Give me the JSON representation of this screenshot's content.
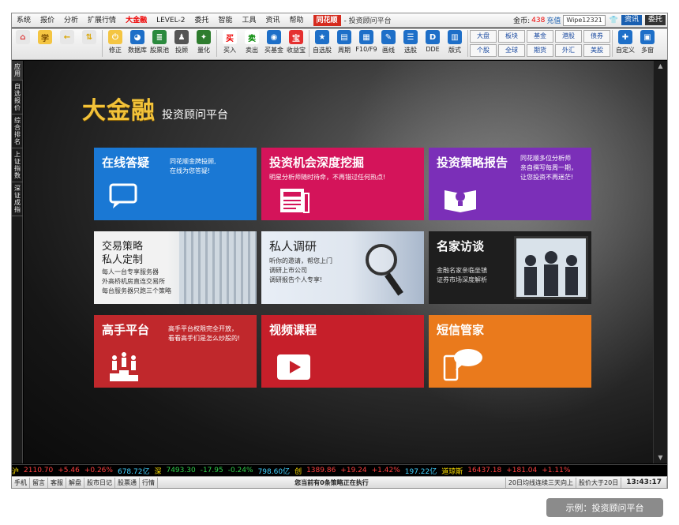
{
  "menu": {
    "items": [
      "系统",
      "报价",
      "分析",
      "扩展行情",
      "大金融",
      "LEVEL-2",
      "委托",
      "智能",
      "工具",
      "资讯",
      "帮助"
    ],
    "logo": "同花顺",
    "title": "- 投资顾问平台",
    "coins_label": "金币:",
    "coins_value": "438",
    "recharge": "充值",
    "user": "Wipe12321",
    "btn_zixun": "资讯",
    "btn_weituo": "委托"
  },
  "toolbar": {
    "buttons": [
      {
        "label": "",
        "icon": "home-icon"
      },
      {
        "label": "",
        "icon": "learn-icon"
      },
      {
        "label": "",
        "icon": "back-icon"
      },
      {
        "label": "",
        "icon": "updown-icon"
      },
      {
        "label": "修正",
        "icon": "power-icon"
      },
      {
        "label": "数据库",
        "icon": "database-icon"
      },
      {
        "label": "股票池",
        "icon": "stockpool-icon"
      },
      {
        "label": "投顾",
        "icon": "advisor-icon"
      },
      {
        "label": "量化",
        "icon": "quant-icon"
      },
      {
        "label": "买入",
        "icon": "buy-icon"
      },
      {
        "label": "卖出",
        "icon": "sell-icon"
      },
      {
        "label": "买基金",
        "icon": "fund-icon"
      },
      {
        "label": "收益宝",
        "icon": "treasure-icon"
      },
      {
        "label": "自选股",
        "icon": "watchlist-icon"
      },
      {
        "label": "周期",
        "icon": "cycle-icon"
      },
      {
        "label": "F10/F9",
        "icon": "f10-icon"
      },
      {
        "label": "画线",
        "icon": "draw-icon"
      },
      {
        "label": "选股",
        "icon": "select-icon"
      },
      {
        "label": "DDE",
        "icon": "dde-icon"
      },
      {
        "label": "版式",
        "icon": "layout-icon"
      }
    ],
    "grid": [
      "大盘",
      "板块",
      "基金",
      "港股",
      "债券",
      "个股",
      "全球",
      "期货",
      "外汇",
      "美股"
    ],
    "right": [
      {
        "label": "自定义",
        "icon": "custom-icon"
      },
      {
        "label": "多窗",
        "icon": "multiwin-icon"
      }
    ],
    "glyphs": {
      "home": "⌂",
      "learn": "学",
      "back": "←",
      "updown": "⇅",
      "power": "⏻",
      "database": "◕",
      "stockpool": "≣",
      "advisor": "♟",
      "quant": "✦",
      "buy": "买",
      "sell": "卖",
      "fund": "◉",
      "treasure": "宝",
      "watchlist": "★",
      "cycle": "▤",
      "f10": "▦",
      "draw": "✎",
      "select": "☰",
      "dde": "D",
      "layout": "▥",
      "custom": "✚",
      "multiwin": "▣"
    }
  },
  "sidetabs": [
    "应用",
    "自选报价",
    "综合排名",
    "上证指数",
    "深证成指"
  ],
  "brand": {
    "big": "大金融",
    "sub": "投资顾问平台"
  },
  "tiles": [
    {
      "title": "在线答疑",
      "desc": [
        "同花顺金牌投顾,",
        "在线为您答疑!"
      ],
      "icon": "chat-icon",
      "color": "#1a78d4"
    },
    {
      "title": "投资机会深度挖掘",
      "desc": [
        "明星分析师随时待命，不再错过任何热点!"
      ],
      "icon": "news-icon",
      "color": "#d4145a"
    },
    {
      "title": "投资策略报告",
      "desc": [
        "同花顺多位分析师",
        "亲自撰写每周一期，",
        "让您投资不再迷茫!"
      ],
      "icon": "report-icon",
      "color": "#7b2fb8"
    },
    {
      "title": "交易策略",
      "title2": "私人定制",
      "desc": [
        "每人一台专享服务器",
        "外高桥机房直连交易所",
        "每台服务器只跑三个策略"
      ],
      "icon": "server-icon",
      "color": "#e6e6e6"
    },
    {
      "title": "私人调研",
      "desc": [
        "听你的邀请，帮您上门",
        "调研上市公司",
        "调研报告个人专享!"
      ],
      "icon": "magnifier-icon",
      "color": "#dadde4"
    },
    {
      "title": "名家访谈",
      "desc": [
        "金融名家亲临坐镇",
        "证券市场深度解析"
      ],
      "icon": "people-icon",
      "color": "#1e1e1e"
    },
    {
      "title": "高手平台",
      "desc": [
        "高手平台权限完全开放，",
        "看看高手们是怎么炒股的!"
      ],
      "icon": "podium-icon",
      "color": "#c0282c"
    },
    {
      "title": "视频课程",
      "desc": [],
      "icon": "play-icon",
      "color": "#c61f2a"
    },
    {
      "title": "短信管家",
      "desc": [],
      "icon": "sms-icon",
      "color": "#ea7a1c"
    }
  ],
  "ticker": {
    "sh_label": "沪",
    "sh_index": "2110.70",
    "sh_change": "+5.46",
    "sh_pct": "+0.26%",
    "sh_amount": "678.72亿",
    "sz_label": "深",
    "sz_index": "7493.30",
    "sz_change": "-17.95",
    "sz_pct": "-0.24%",
    "sz_amount": "798.60亿",
    "cy_label": "创",
    "cy_index": "1389.86",
    "cy_change": "+19.24",
    "cy_pct": "+1.42%",
    "cy_amount": "197.22亿",
    "dj_label": "道琼斯",
    "dj_index": "16437.18",
    "dj_change": "+181.04",
    "dj_pct": "+1.11%"
  },
  "status": {
    "items": [
      "手机",
      "留言",
      "客服",
      "解盘",
      "股市日记",
      "股票通",
      "行情"
    ],
    "message": "您当前有0条策略正在执行",
    "right1": "20日均线连续三天向上",
    "right2": "股价大于20日",
    "time": "13:43:17"
  },
  "caption": "示例：投资顾问平台"
}
